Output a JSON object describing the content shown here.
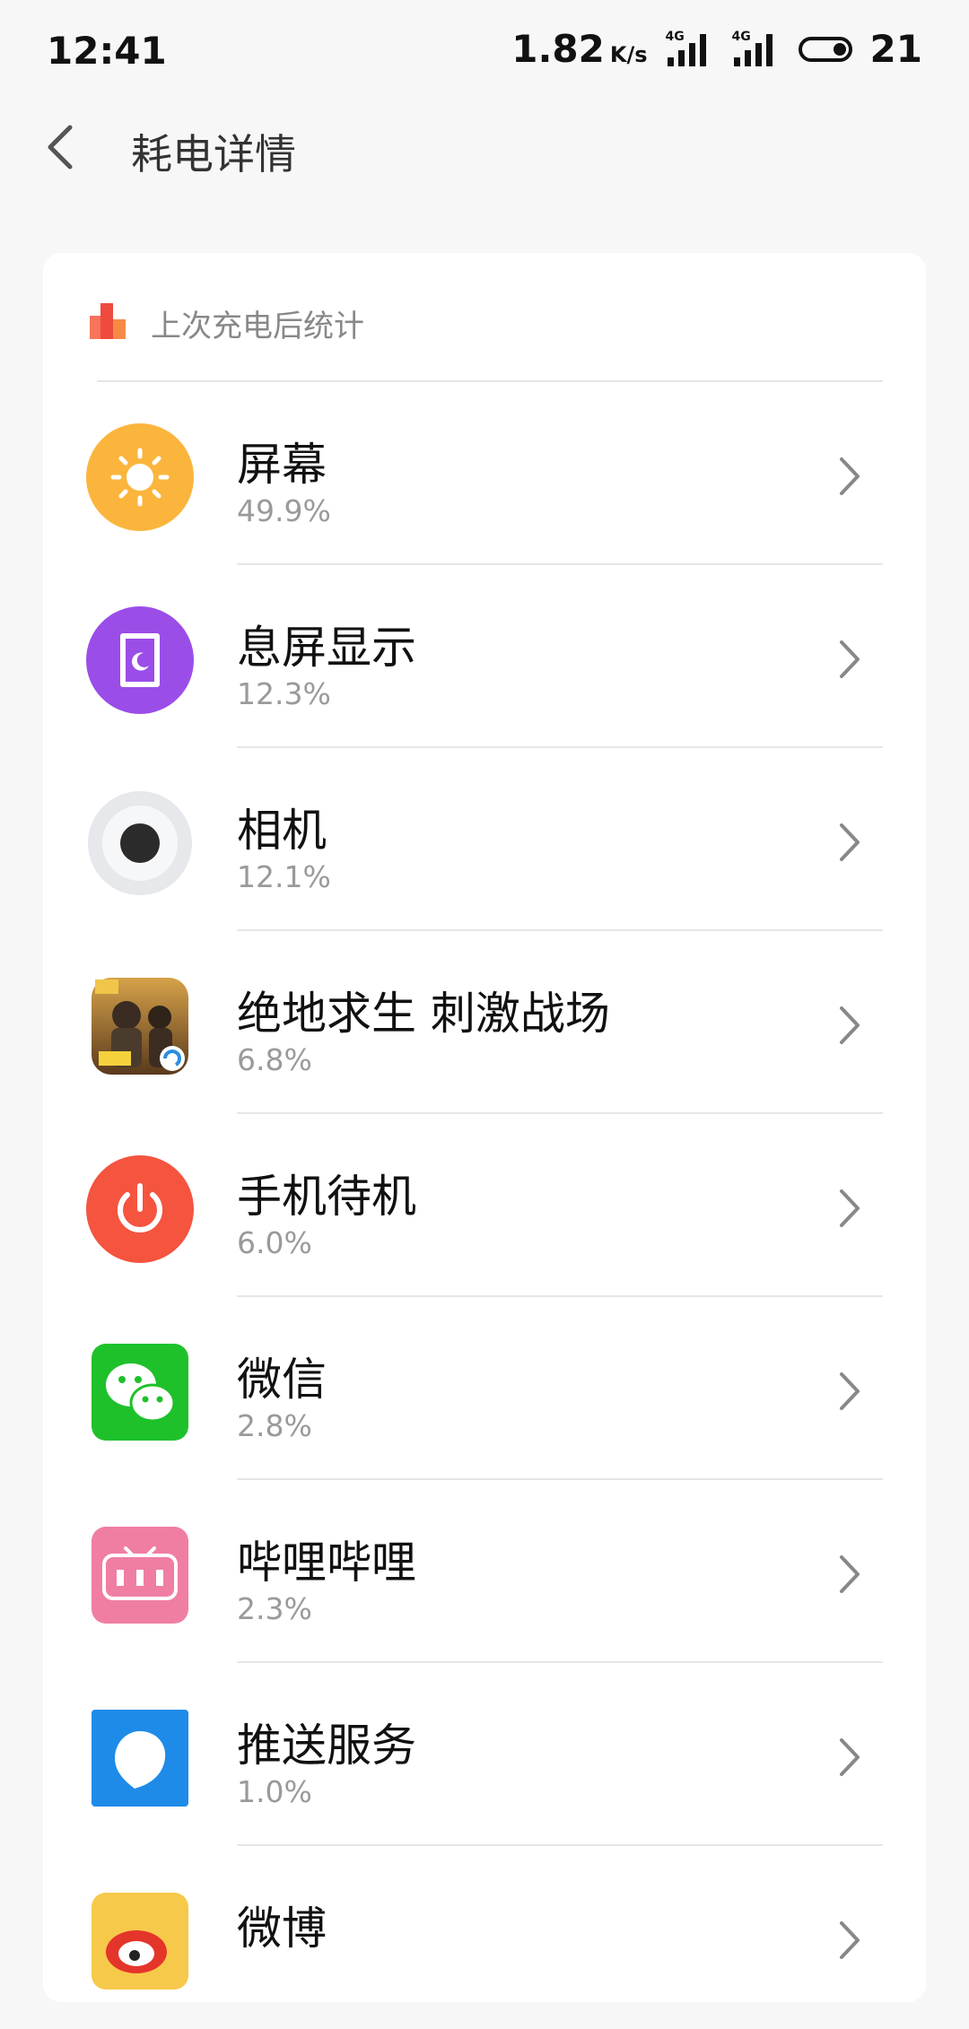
{
  "status": {
    "time": "12:41",
    "speed": "1.82",
    "speed_unit": "K/s",
    "network_tag_1": "4G",
    "network_tag_2": "4G",
    "battery": "21"
  },
  "header": {
    "title": "耗电详情"
  },
  "card": {
    "label": "上次充电后统计"
  },
  "items": [
    {
      "name": "屏幕",
      "percent": "49.9%",
      "icon": "brightness-icon",
      "color": "#fbb53c"
    },
    {
      "name": "息屏显示",
      "percent": "12.3%",
      "icon": "ambient-display-icon",
      "color": "#9b4de8"
    },
    {
      "name": "相机",
      "percent": "12.1%",
      "icon": "camera-icon",
      "color": "#e9eaee"
    },
    {
      "name": "绝地求生 刺激战场",
      "percent": "6.8%",
      "icon": "pubg-app-icon",
      "color": "#c0832e"
    },
    {
      "name": "手机待机",
      "percent": "6.0%",
      "icon": "power-icon",
      "color": "#f5543f"
    },
    {
      "name": "微信",
      "percent": "2.8%",
      "icon": "wechat-icon",
      "color": "#1fc12b"
    },
    {
      "name": "哔哩哔哩",
      "percent": "2.3%",
      "icon": "bilibili-icon",
      "color": "#f07ea3"
    },
    {
      "name": "推送服务",
      "percent": "1.0%",
      "icon": "push-service-icon",
      "color": "#1e8be8"
    },
    {
      "name": "微博",
      "percent": "",
      "icon": "weibo-icon",
      "color": "#f7c94a"
    }
  ]
}
